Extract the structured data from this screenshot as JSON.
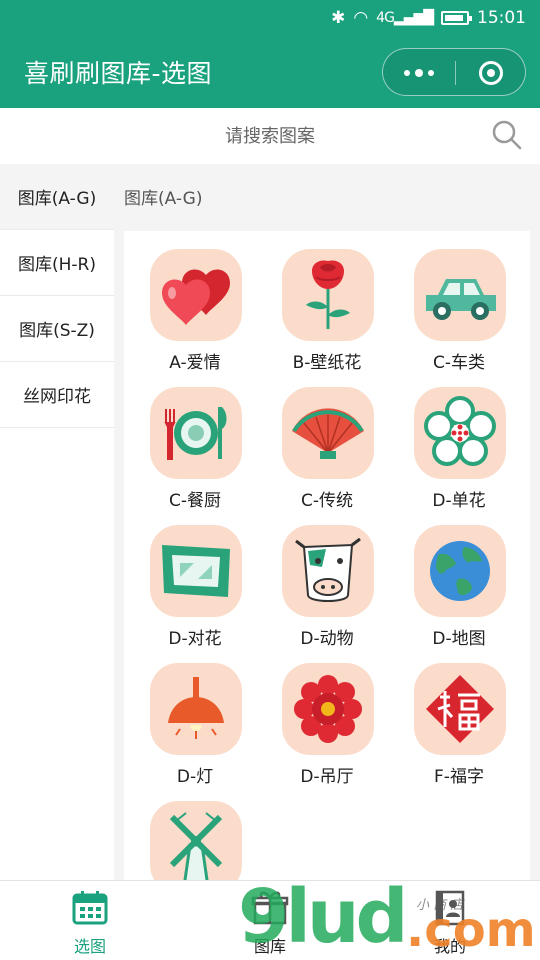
{
  "status": {
    "time": "15:01",
    "network": "4G"
  },
  "header": {
    "title": "喜刷刷图库-选图"
  },
  "search": {
    "placeholder": "请搜索图案"
  },
  "sidebar": {
    "items": [
      {
        "label": "图库(A-G)",
        "active": true
      },
      {
        "label": "图库(H-R)",
        "active": false
      },
      {
        "label": "图库(S-Z)",
        "active": false
      },
      {
        "label": "丝网印花",
        "active": false
      }
    ]
  },
  "content": {
    "title": "图库(A-G)",
    "items": [
      {
        "label": "A-爱情",
        "icon": "hearts-icon"
      },
      {
        "label": "B-壁纸花",
        "icon": "rose-icon"
      },
      {
        "label": "C-车类",
        "icon": "car-icon"
      },
      {
        "label": "C-餐厨",
        "icon": "tableware-icon"
      },
      {
        "label": "C-传统",
        "icon": "fan-icon"
      },
      {
        "label": "D-单花",
        "icon": "plum-blossom-icon"
      },
      {
        "label": "D-对花",
        "icon": "frame-icon"
      },
      {
        "label": "D-动物",
        "icon": "cow-icon"
      },
      {
        "label": "D-地图",
        "icon": "globe-icon"
      },
      {
        "label": "D-灯",
        "icon": "lamp-icon"
      },
      {
        "label": "D-吊厅",
        "icon": "flower-icon"
      },
      {
        "label": "F-福字",
        "icon": "fu-character-icon"
      },
      {
        "label": "",
        "icon": "windmill-icon"
      }
    ]
  },
  "tabbar": {
    "items": [
      {
        "label": "选图",
        "icon": "calendar-icon",
        "active": true
      },
      {
        "label": "图库",
        "icon": "gift-icon",
        "active": false
      },
      {
        "label": "我的",
        "icon": "contact-book-icon",
        "active": false
      }
    ]
  },
  "watermark": {
    "text": "9lud",
    "suffix": ".com",
    "sub": "小 商 店"
  },
  "colors": {
    "brand": "#1aa17e",
    "tile_bg": "#fbdccb",
    "active_tab": "#1aa17e"
  }
}
